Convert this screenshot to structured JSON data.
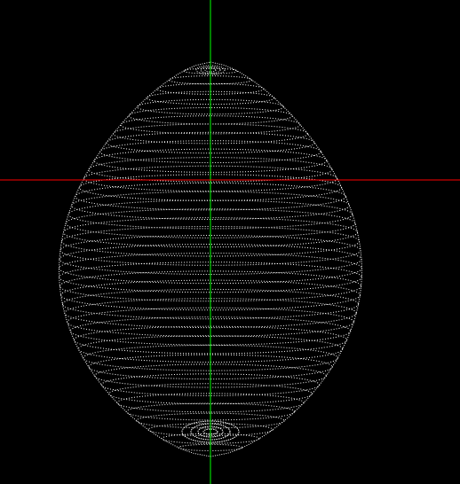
{
  "canvas": {
    "background_color": "#000000"
  },
  "scene": {
    "object": "egg",
    "render_style": "white dotted horizontal latitude rings",
    "point_color": "#ffffff"
  },
  "axes": {
    "vertical_axis_color": "#00ff00",
    "horizontal_axis_color": "#ff0000"
  }
}
